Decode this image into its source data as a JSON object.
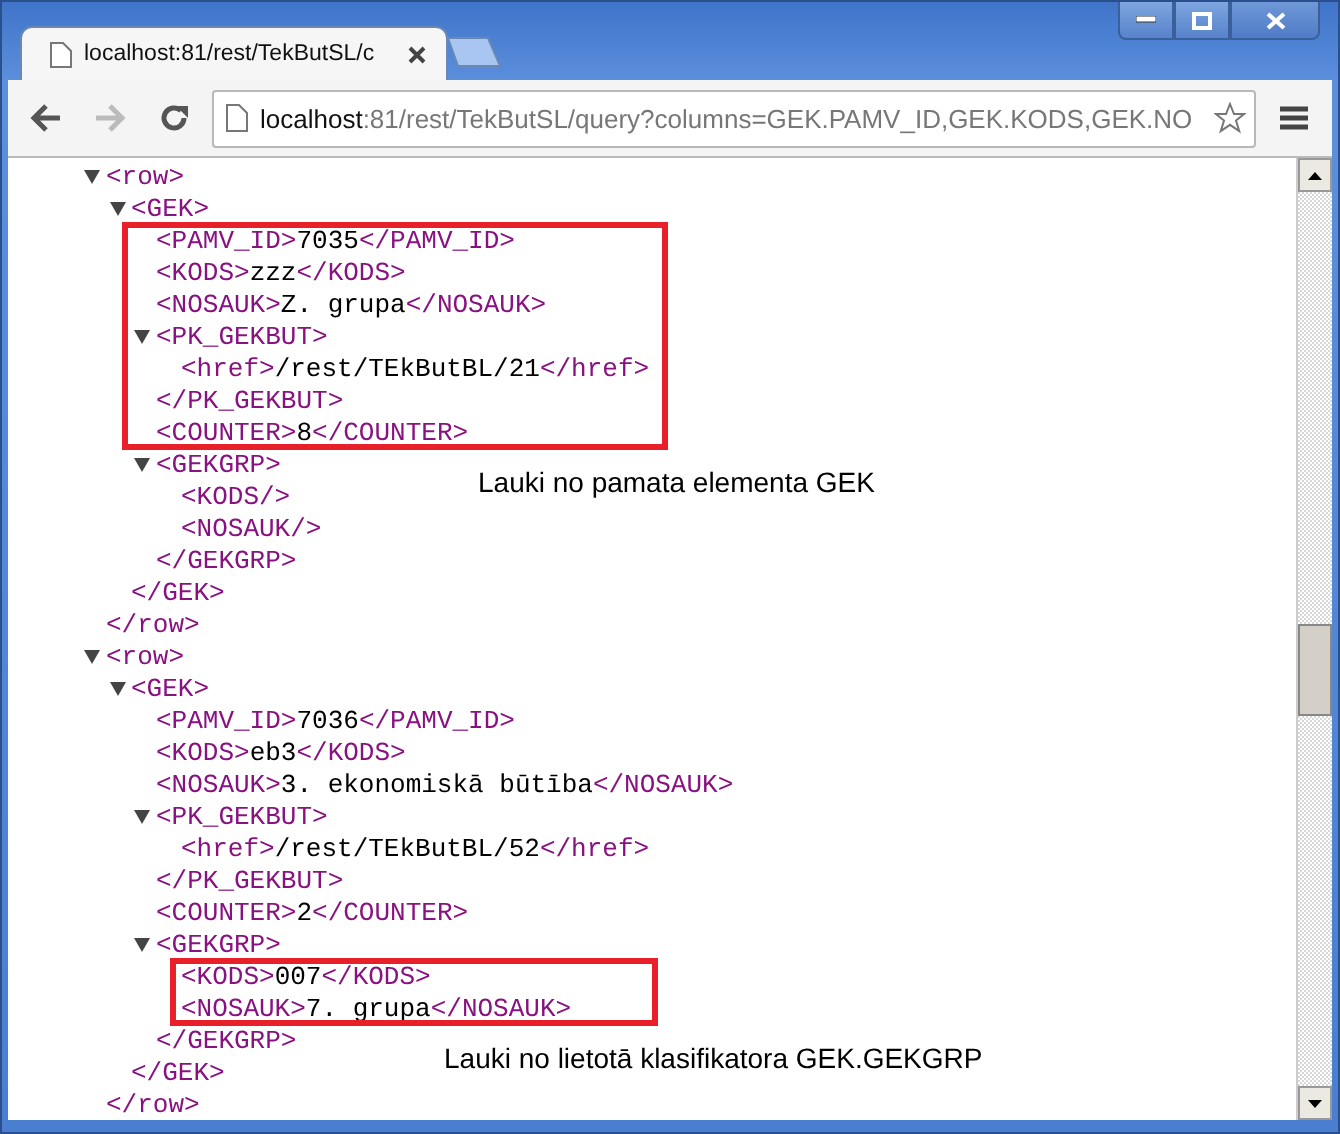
{
  "tabs": [
    {
      "title": "localhost:81/rest/TekButSL/c",
      "selected": true
    }
  ],
  "address": {
    "host": "localhost",
    "rest": ":81/rest/TekButSL/query?columns=GEK.PAMV_ID,GEK.KODS,GEK.NO"
  },
  "xml": [
    {
      "open": "<row>",
      "expanded": true,
      "close": "</row>",
      "children": [
        {
          "open": "<GEK>",
          "expanded": true,
          "close": "</GEK>",
          "children": [
            {
              "open": "<PAMV_ID>",
              "value": "7035",
              "close": "</PAMV_ID>"
            },
            {
              "open": "<KODS>",
              "value": "zzz",
              "close": "</KODS>"
            },
            {
              "open": "<NOSAUK>",
              "value": "Z. grupa",
              "close": "</NOSAUK>"
            },
            {
              "open": "<PK_GEKBUT>",
              "expanded": true,
              "close": "</PK_GEKBUT>",
              "children": [
                {
                  "open": "<href>",
                  "value": "/rest/TEkButBL/21",
                  "close": "</href>"
                }
              ]
            },
            {
              "open": "<COUNTER>",
              "value": "8",
              "close": "</COUNTER>"
            },
            {
              "open": "<GEKGRP>",
              "expanded": true,
              "close": "</GEKGRP>",
              "children": [
                {
                  "open": "<KODS/>"
                },
                {
                  "open": "<NOSAUK/>"
                }
              ]
            }
          ]
        }
      ]
    },
    {
      "open": "<row>",
      "expanded": true,
      "close": "</row>",
      "children": [
        {
          "open": "<GEK>",
          "expanded": true,
          "close": "</GEK>",
          "children": [
            {
              "open": "<PAMV_ID>",
              "value": "7036",
              "close": "</PAMV_ID>"
            },
            {
              "open": "<KODS>",
              "value": "eb3",
              "close": "</KODS>"
            },
            {
              "open": "<NOSAUK>",
              "value": "3. ekonomiskā būtība",
              "close": "</NOSAUK>"
            },
            {
              "open": "<PK_GEKBUT>",
              "expanded": true,
              "close": "</PK_GEKBUT>",
              "children": [
                {
                  "open": "<href>",
                  "value": "/rest/TEkButBL/52",
                  "close": "</href>"
                }
              ]
            },
            {
              "open": "<COUNTER>",
              "value": "2",
              "close": "</COUNTER>"
            },
            {
              "open": "<GEKGRP>",
              "expanded": true,
              "close": "</GEKGRP>",
              "children": [
                {
                  "open": "<KODS>",
                  "value": "007",
                  "close": "</KODS>"
                },
                {
                  "open": "<NOSAUK>",
                  "value": "7. grupa",
                  "close": "</NOSAUK>"
                }
              ]
            }
          ]
        }
      ]
    }
  ],
  "annotations": [
    {
      "text": "Lauki no pamata elementa GEK"
    },
    {
      "text": "Lauki no lietotā klasifikatora GEK.GEKGRP"
    }
  ]
}
